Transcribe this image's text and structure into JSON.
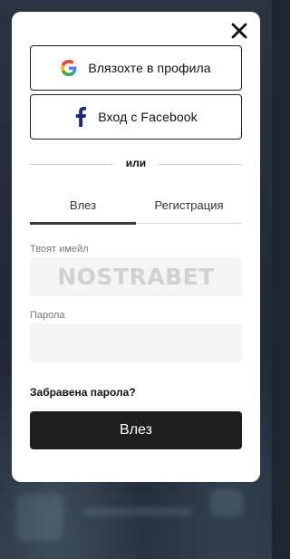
{
  "modal": {
    "social": {
      "google_label": "Влязохте в профила",
      "facebook_label": "Вход с Facebook"
    },
    "divider_text": "или",
    "tabs": [
      {
        "label": "Влез",
        "active": true
      },
      {
        "label": "Регистрация",
        "active": false
      }
    ],
    "email": {
      "label": "Твоят имейл",
      "value": "",
      "placeholder": ""
    },
    "password": {
      "label": "Парола",
      "value": "",
      "placeholder": ""
    },
    "forgot_password": "Забравена парола?",
    "submit_label": "Влез",
    "watermark": "NOSTRABET"
  },
  "colors": {
    "google_blue": "#4285F4",
    "google_red": "#EA4335",
    "google_yellow": "#FBBC05",
    "google_green": "#34A853",
    "facebook_blue": "#1877F2",
    "button_dark": "#1e1e1e"
  },
  "icons": [
    "close-icon",
    "google-icon",
    "facebook-icon"
  ]
}
